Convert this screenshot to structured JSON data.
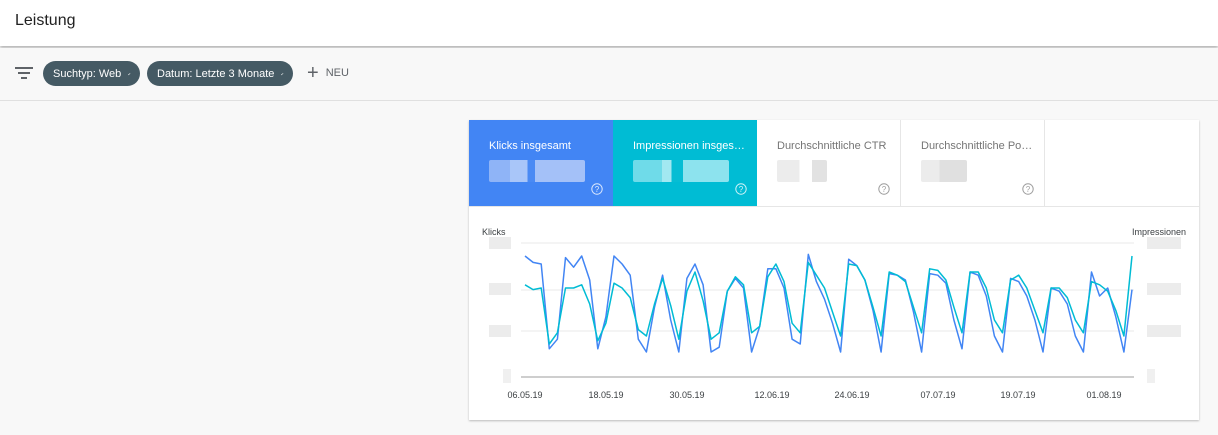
{
  "header": {
    "title": "Leistung"
  },
  "filters": {
    "filter_icon": "filter-list-icon",
    "chips": [
      {
        "label": "Suchtyp: Web",
        "icon": "edit-pencil-icon"
      },
      {
        "label": "Datum: Letzte 3 Monate",
        "icon": "edit-pencil-icon"
      }
    ],
    "new_label": "NEU"
  },
  "metrics": [
    {
      "label": "Klicks insgesamt",
      "color": "#4285f4",
      "selected": true,
      "value_hidden": true
    },
    {
      "label": "Impressionen insges…",
      "color": "#00bcd4",
      "selected": true,
      "value_hidden": true
    },
    {
      "label": "Durchschnittliche CTR",
      "color": "#ffffff",
      "selected": false,
      "value_hidden": true
    },
    {
      "label": "Durchschnittliche Po…",
      "color": "#ffffff",
      "selected": false,
      "value_hidden": true
    }
  ],
  "chart_data": {
    "type": "line",
    "ylabel_left": "Klicks",
    "ylabel_right": "Impressionen",
    "y_tick_labels_hidden": true,
    "x_ticks": [
      "06.05.19",
      "18.05.19",
      "30.05.19",
      "12.06.19",
      "24.06.19",
      "07.07.19",
      "19.07.19",
      "01.08.19"
    ],
    "grid": true,
    "series": [
      {
        "color": "#4285f4",
        "values": [
          100,
          96,
          95,
          42,
          48,
          99,
          93,
          100,
          85,
          42,
          62,
          100,
          95,
          88,
          48,
          40,
          68,
          88,
          60,
          40,
          86,
          95,
          82,
          40,
          43,
          78,
          86,
          80,
          40,
          56,
          92,
          92,
          80,
          48,
          45,
          101,
          84,
          73,
          58,
          40,
          98,
          94,
          85,
          66,
          40,
          89,
          88,
          85,
          65,
          40,
          89,
          88,
          83,
          60,
          42,
          90,
          88,
          75,
          50,
          40,
          86,
          84,
          75,
          60,
          40,
          80,
          78,
          70,
          50,
          40,
          90,
          75,
          80,
          62,
          40,
          79
        ]
      },
      {
        "color": "#00bcd4",
        "values": [
          82,
          79,
          80,
          45,
          52,
          80,
          80,
          82,
          70,
          47,
          58,
          83,
          80,
          74,
          54,
          50,
          70,
          86,
          69,
          48,
          78,
          90,
          72,
          48,
          52,
          78,
          87,
          82,
          52,
          56,
          87,
          95,
          84,
          58,
          52,
          96,
          88,
          80,
          65,
          50,
          95,
          94,
          85,
          68,
          50,
          90,
          88,
          84,
          68,
          52,
          92,
          91,
          85,
          68,
          52,
          90,
          90,
          80,
          60,
          52,
          85,
          88,
          80,
          66,
          52,
          80,
          80,
          74,
          60,
          52,
          84,
          82,
          78,
          66,
          50,
          100
        ]
      }
    ]
  }
}
